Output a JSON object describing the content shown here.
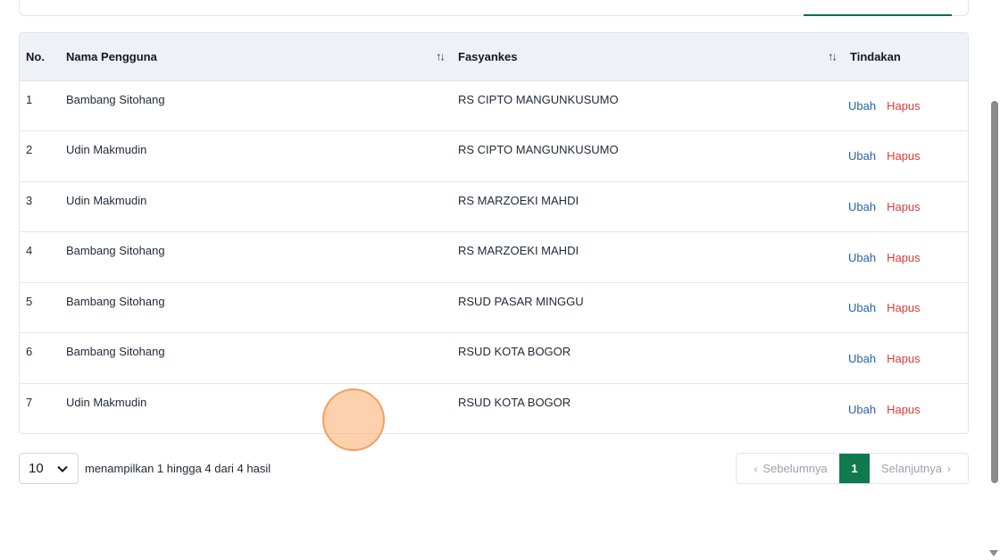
{
  "table": {
    "headers": {
      "no": "No.",
      "user": "Nama Pengguna",
      "fasyankes": "Fasyankes",
      "actions": "Tindakan"
    },
    "rows": [
      {
        "no": "1",
        "user": "Bambang Sitohang",
        "fasyankes": "RS CIPTO MANGUNKUSUMO",
        "edit": "Ubah",
        "delete": "Hapus"
      },
      {
        "no": "2",
        "user": "Udin Makmudin",
        "fasyankes": "RS CIPTO MANGUNKUSUMO",
        "edit": "Ubah",
        "delete": "Hapus"
      },
      {
        "no": "3",
        "user": "Udin Makmudin",
        "fasyankes": "RS MARZOEKI MAHDI",
        "edit": "Ubah",
        "delete": "Hapus"
      },
      {
        "no": "4",
        "user": "Bambang Sitohang",
        "fasyankes": "RS MARZOEKI MAHDI",
        "edit": "Ubah",
        "delete": "Hapus"
      },
      {
        "no": "5",
        "user": "Bambang Sitohang",
        "fasyankes": "RSUD PASAR MINGGU",
        "edit": "Ubah",
        "delete": "Hapus"
      },
      {
        "no": "6",
        "user": "Bambang Sitohang",
        "fasyankes": "RSUD KOTA BOGOR",
        "edit": "Ubah",
        "delete": "Hapus"
      },
      {
        "no": "7",
        "user": "Udin Makmudin",
        "fasyankes": "RSUD KOTA BOGOR",
        "edit": "Ubah",
        "delete": "Hapus"
      }
    ]
  },
  "footer": {
    "page_size": "10",
    "result_text": "menampilkan 1 hingga 4 dari 4 hasil",
    "prev_label": "Sebelumnya",
    "current_page": "1",
    "next_label": "Selanjutnya"
  },
  "colors": {
    "accent": "#0f7a4e",
    "edit_link": "#2563a8",
    "delete_link": "#dc3b3b",
    "header_bg": "#eef2f7"
  },
  "icons": {
    "sort": "sort-icon",
    "page_size_toggle": "chevron-down-icon",
    "prev": "chevron-left-icon",
    "next": "chevron-right-icon"
  }
}
